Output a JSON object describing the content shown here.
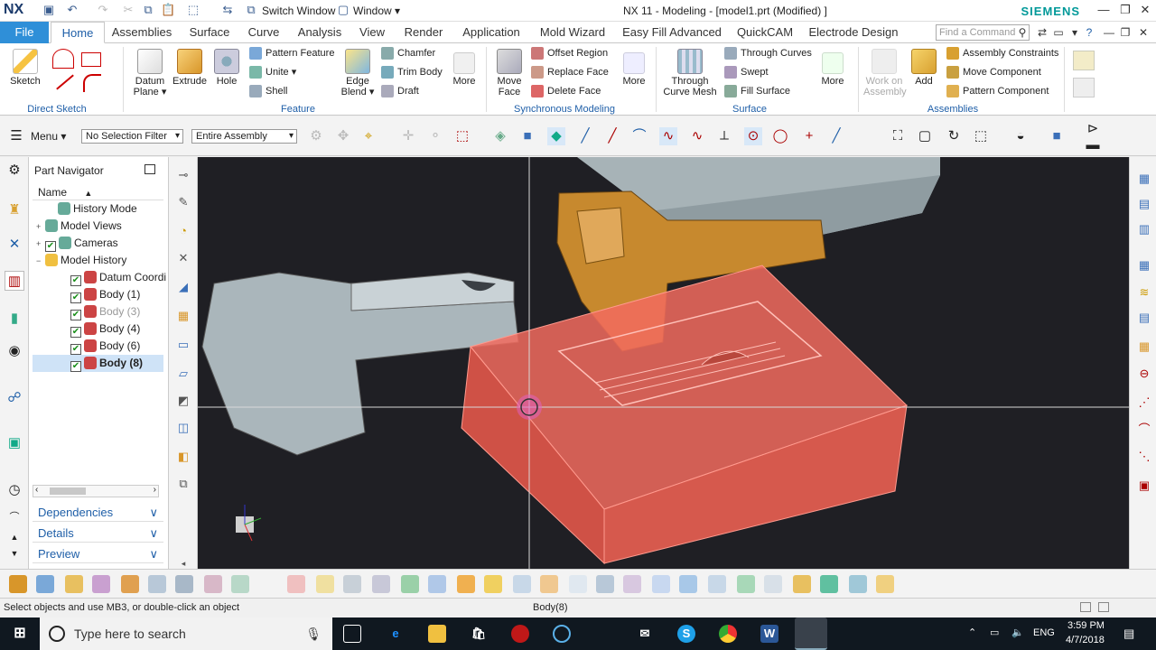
{
  "title_bar": {
    "app_logo": "NX",
    "switch_window_label": "Switch Window",
    "window_menu_label": "Window ▾",
    "title": "NX 11 - Modeling - [model1.prt (Modified) ]",
    "brand": "SIEMENS"
  },
  "tabs": {
    "file": "File",
    "items": [
      "Home",
      "Assemblies",
      "Surface",
      "Curve",
      "Analysis",
      "View",
      "Render",
      "Application",
      "Mold Wizard",
      "Easy Fill Advanced",
      "QuickCAM",
      "Electrode Design"
    ],
    "active": "Home",
    "find_placeholder": "Find a Command"
  },
  "ribbon": {
    "direct_sketch": {
      "label": "Direct Sketch",
      "sketch": "Sketch"
    },
    "feature": {
      "label": "Feature",
      "datum_plane": "Datum Plane ▾",
      "extrude": "Extrude",
      "hole": "Hole",
      "pattern_feature": "Pattern Feature",
      "unite": "Unite ▾",
      "shell": "Shell",
      "edge_blend": "Edge Blend ▾",
      "chamfer": "Chamfer",
      "trim_body": "Trim Body",
      "draft": "Draft",
      "more": "More"
    },
    "synchronous": {
      "label": "Synchronous Modeling",
      "move_face": "Move Face",
      "offset_region": "Offset Region",
      "replace_face": "Replace Face",
      "delete_face": "Delete Face",
      "more": "More"
    },
    "surface": {
      "label": "Surface",
      "through_curve_mesh": "Through Curve Mesh",
      "through_curves": "Through Curves",
      "swept": "Swept",
      "fill_surface": "Fill Surface",
      "more": "More"
    },
    "assemblies": {
      "label": "Assemblies",
      "work_on_assembly": "Work on Assembly",
      "add": "Add",
      "assembly_constraints": "Assembly Constraints",
      "move_component": "Move Component",
      "pattern_component": "Pattern Component"
    }
  },
  "selection_bar": {
    "menu": "Menu ▾",
    "filter": "No Selection Filter",
    "scope": "Entire Assembly"
  },
  "navigator": {
    "title": "Part Navigator",
    "column": "Name",
    "rows": [
      {
        "label": "History Mode",
        "indent": 1,
        "toggle": "",
        "check": false,
        "dim": false,
        "selected": false
      },
      {
        "label": "Model Views",
        "indent": 0,
        "toggle": "+",
        "check": false,
        "dim": false,
        "selected": false
      },
      {
        "label": "Cameras",
        "indent": 0,
        "toggle": "+",
        "check": true,
        "dim": false,
        "selected": false
      },
      {
        "label": "Model History",
        "indent": 0,
        "toggle": "−",
        "check": false,
        "dim": false,
        "selected": false
      },
      {
        "label": "Datum Coordi",
        "indent": 2,
        "toggle": "",
        "check": true,
        "dim": false,
        "selected": false
      },
      {
        "label": "Body (1)",
        "indent": 2,
        "toggle": "",
        "check": true,
        "dim": false,
        "selected": false
      },
      {
        "label": "Body (3)",
        "indent": 2,
        "toggle": "",
        "check": true,
        "dim": true,
        "selected": false
      },
      {
        "label": "Body (4)",
        "indent": 2,
        "toggle": "",
        "check": true,
        "dim": false,
        "selected": false
      },
      {
        "label": "Body (6)",
        "indent": 2,
        "toggle": "",
        "check": true,
        "dim": false,
        "selected": false
      },
      {
        "label": "Body (8)",
        "indent": 2,
        "toggle": "",
        "check": true,
        "dim": false,
        "selected": true
      }
    ],
    "sections": [
      "Dependencies",
      "Details",
      "Preview"
    ]
  },
  "status": {
    "prompt": "Select objects and use MB3, or double-click an object",
    "selection": "Body(8)"
  },
  "taskbar": {
    "search_placeholder": "Type here to search",
    "language": "ENG",
    "time": "3:59 PM",
    "date": "4/7/2018"
  },
  "colors": {
    "accent": "#1f5fa8",
    "file_tab": "#2f8fd8",
    "brand": "#009999",
    "viewport_bg": "#1f1f24",
    "highlight_body": "#f26b5e",
    "taskbar": "#101820"
  }
}
